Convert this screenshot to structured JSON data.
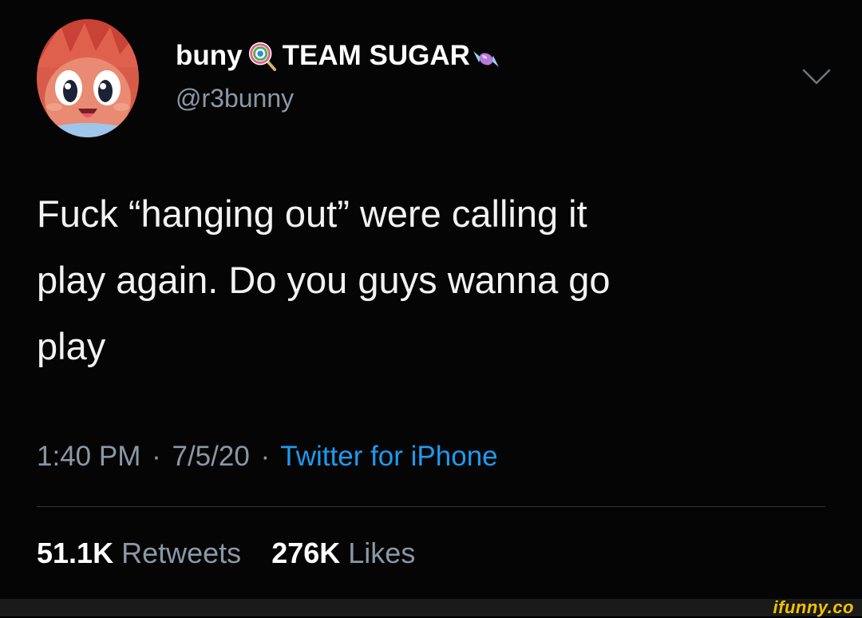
{
  "tweet": {
    "author": {
      "name_part1": "buny",
      "name_part2": "TEAM SUGAR",
      "handle": "@r3bunny",
      "name_icons": [
        "lollipop-icon",
        "candy-icon"
      ]
    },
    "text": "Fuck “hanging out” were calling it\nplay again. Do you guys wanna go\nplay",
    "time": "1:40 PM",
    "date": "7/5/20",
    "source": "Twitter for iPhone",
    "separator": "·",
    "retweets": {
      "count": "51.1K",
      "label": "Retweets"
    },
    "likes": {
      "count": "276K",
      "label": "Likes"
    }
  },
  "watermark": "ifunny.co",
  "colors": {
    "background": "#050505",
    "text": "#f2f2f2",
    "muted": "#8b98a5",
    "link": "#1d9bf0",
    "avatar_bg": "#d85b4a"
  },
  "icons": {
    "more": "chevron-down-icon"
  }
}
